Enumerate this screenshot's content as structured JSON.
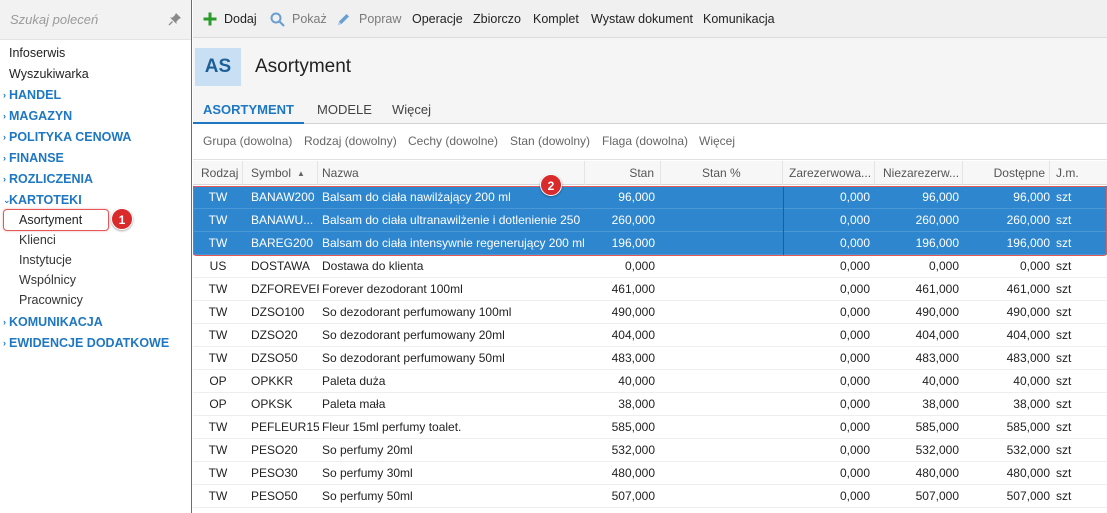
{
  "sidebar": {
    "search_placeholder": "Szukaj poleceń",
    "top_items": [
      "Infoserwis",
      "Wyszukiwarka"
    ],
    "groups": {
      "handel": "HANDEL",
      "magazyn": "MAGAZYN",
      "polityka": "POLITYKA CENOWA",
      "finanse": "FINANSE",
      "rozliczenia": "ROZLICZENIA",
      "kartoteki": "KARTOTEKI",
      "komunikacja": "KOMUNIKACJA",
      "ewidencje": "EWIDENCJE DODATKOWE"
    },
    "kartoteki_items": [
      "Asortyment",
      "Klienci",
      "Instytucje",
      "Wspólnicy",
      "Pracownicy"
    ],
    "badge_1": "1"
  },
  "toolbar": {
    "add": "Dodaj",
    "show": "Pokaż",
    "edit": "Popraw",
    "operations": "Operacje",
    "bulk": "Zbiorczo",
    "set": "Komplet",
    "issue_doc": "Wystaw dokument",
    "communication": "Komunikacja"
  },
  "header": {
    "logo": "AS",
    "title": "Asortyment"
  },
  "tabs": {
    "assortment": "ASORTYMENT",
    "models": "MODELE",
    "more": "Więcej"
  },
  "filters": [
    "Grupa (dowolna)",
    "Rodzaj (dowolny)",
    "Cechy (dowolne)",
    "Stan (dowolny)",
    "Flaga (dowolna)",
    "Więcej"
  ],
  "grid": {
    "columns": {
      "type": "Rodzaj",
      "symbol": "Symbol",
      "name": "Nazwa",
      "stock": "Stan",
      "stock_pct": "Stan %",
      "reserved": "Zarezerwowa...",
      "unreserved": "Niezarezerw...",
      "available": "Dostępne",
      "unit": "J.m."
    },
    "badge_2": "2",
    "rows": [
      {
        "type": "TW",
        "symbol": "BANAW200",
        "name": "Balsam do ciała nawilżający 200 ml",
        "stock": "96,000",
        "stock_pct": "",
        "reserved": "0,000",
        "unreserved": "96,000",
        "available": "96,000",
        "unit": "szt",
        "selected": true
      },
      {
        "type": "TW",
        "symbol": "BANAWU...",
        "name": "Balsam do ciała ultranawilżenie i dotlenienie 250",
        "stock": "260,000",
        "stock_pct": "",
        "reserved": "0,000",
        "unreserved": "260,000",
        "available": "260,000",
        "unit": "szt",
        "selected": true
      },
      {
        "type": "TW",
        "symbol": "BAREG200",
        "name": "Balsam do ciała intensywnie regenerujący 200 ml",
        "stock": "196,000",
        "stock_pct": "",
        "reserved": "0,000",
        "unreserved": "196,000",
        "available": "196,000",
        "unit": "szt",
        "selected": true
      },
      {
        "type": "US",
        "symbol": "DOSTAWA",
        "name": "Dostawa do klienta",
        "stock": "0,000",
        "stock_pct": "",
        "reserved": "0,000",
        "unreserved": "0,000",
        "available": "0,000",
        "unit": "szt",
        "selected": false
      },
      {
        "type": "TW",
        "symbol": "DZFOREVER",
        "name": "Forever dezodorant 100ml",
        "stock": "461,000",
        "stock_pct": "",
        "reserved": "0,000",
        "unreserved": "461,000",
        "available": "461,000",
        "unit": "szt",
        "selected": false
      },
      {
        "type": "TW",
        "symbol": "DZSO100",
        "name": "So dezodorant perfumowany 100ml",
        "stock": "490,000",
        "stock_pct": "",
        "reserved": "0,000",
        "unreserved": "490,000",
        "available": "490,000",
        "unit": "szt",
        "selected": false
      },
      {
        "type": "TW",
        "symbol": "DZSO20",
        "name": "So dezodorant perfumowany 20ml",
        "stock": "404,000",
        "stock_pct": "",
        "reserved": "0,000",
        "unreserved": "404,000",
        "available": "404,000",
        "unit": "szt",
        "selected": false
      },
      {
        "type": "TW",
        "symbol": "DZSO50",
        "name": "So dezodorant perfumowany 50ml",
        "stock": "483,000",
        "stock_pct": "",
        "reserved": "0,000",
        "unreserved": "483,000",
        "available": "483,000",
        "unit": "szt",
        "selected": false
      },
      {
        "type": "OP",
        "symbol": "OPKKR",
        "name": "Paleta duża",
        "stock": "40,000",
        "stock_pct": "",
        "reserved": "0,000",
        "unreserved": "40,000",
        "available": "40,000",
        "unit": "szt",
        "selected": false
      },
      {
        "type": "OP",
        "symbol": "OPKSK",
        "name": "Paleta mała",
        "stock": "38,000",
        "stock_pct": "",
        "reserved": "0,000",
        "unreserved": "38,000",
        "available": "38,000",
        "unit": "szt",
        "selected": false
      },
      {
        "type": "TW",
        "symbol": "PEFLEUR15",
        "name": "Fleur 15ml perfumy toalet.",
        "stock": "585,000",
        "stock_pct": "",
        "reserved": "0,000",
        "unreserved": "585,000",
        "available": "585,000",
        "unit": "szt",
        "selected": false
      },
      {
        "type": "TW",
        "symbol": "PESO20",
        "name": "So perfumy 20ml",
        "stock": "532,000",
        "stock_pct": "",
        "reserved": "0,000",
        "unreserved": "532,000",
        "available": "532,000",
        "unit": "szt",
        "selected": false
      },
      {
        "type": "TW",
        "symbol": "PESO30",
        "name": "So perfumy 30ml",
        "stock": "480,000",
        "stock_pct": "",
        "reserved": "0,000",
        "unreserved": "480,000",
        "available": "480,000",
        "unit": "szt",
        "selected": false
      },
      {
        "type": "TW",
        "symbol": "PESO50",
        "name": "So perfumy 50ml",
        "stock": "507,000",
        "stock_pct": "",
        "reserved": "0,000",
        "unreserved": "507,000",
        "available": "507,000",
        "unit": "szt",
        "selected": false
      }
    ]
  },
  "colors": {
    "accent": "#1e77c2",
    "selection": "#2e86cf",
    "badge": "#d92b2b",
    "highlight_outline": "#e05a5a"
  }
}
